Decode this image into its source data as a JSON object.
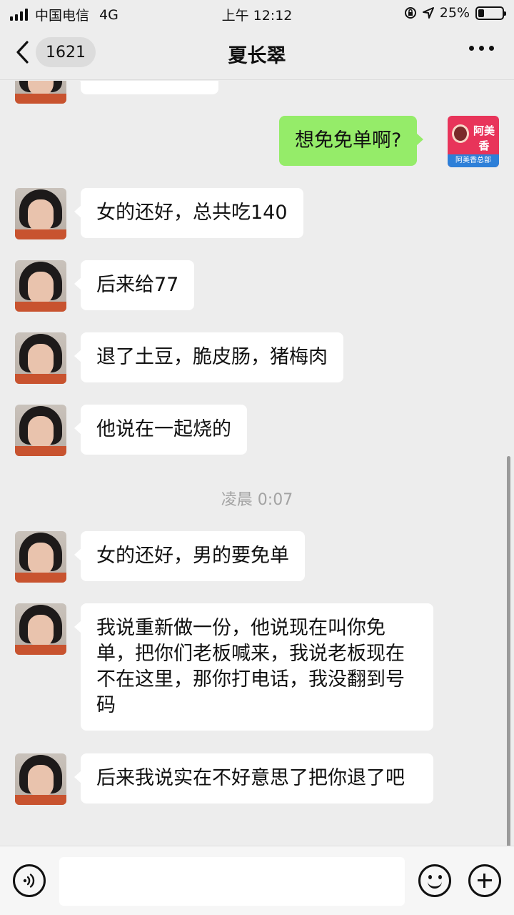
{
  "status_bar": {
    "carrier": "中国电信",
    "network": "4G",
    "time": "上午 12:12",
    "battery": "25%",
    "battery_level": 0.25
  },
  "nav": {
    "unread_count": "1621",
    "title": "夏长翠"
  },
  "messages": [
    {
      "side": "left",
      "text": ""
    },
    {
      "side": "right",
      "text": "想免免单啊?"
    },
    {
      "side": "left",
      "text": "女的还好，总共吃140"
    },
    {
      "side": "left",
      "text": "后来给77"
    },
    {
      "side": "left",
      "text": "退了土豆，脆皮肠，猪梅肉"
    },
    {
      "side": "left",
      "text": "他说在一起烧的"
    },
    {
      "timestamp": "凌晨 0:07"
    },
    {
      "side": "left",
      "text": "女的还好，男的要免单"
    },
    {
      "side": "left",
      "text": "我说重新做一份，他说现在叫你免单，把你们老板喊来，我说老板现在不在这里，那你打电话，我没翻到号码"
    },
    {
      "side": "left",
      "text": "后来我说实在不好意思了把你退了吧"
    }
  ],
  "self_avatar": {
    "logo_text": "阿美香",
    "footer_text": "阿美香总部"
  },
  "input": {
    "value": "",
    "placeholder": ""
  },
  "icons": {
    "back": "chevron-left-icon",
    "more": "more-dots-icon",
    "voice": "voice-icon",
    "emoji": "emoji-icon",
    "plus": "plus-icon"
  }
}
